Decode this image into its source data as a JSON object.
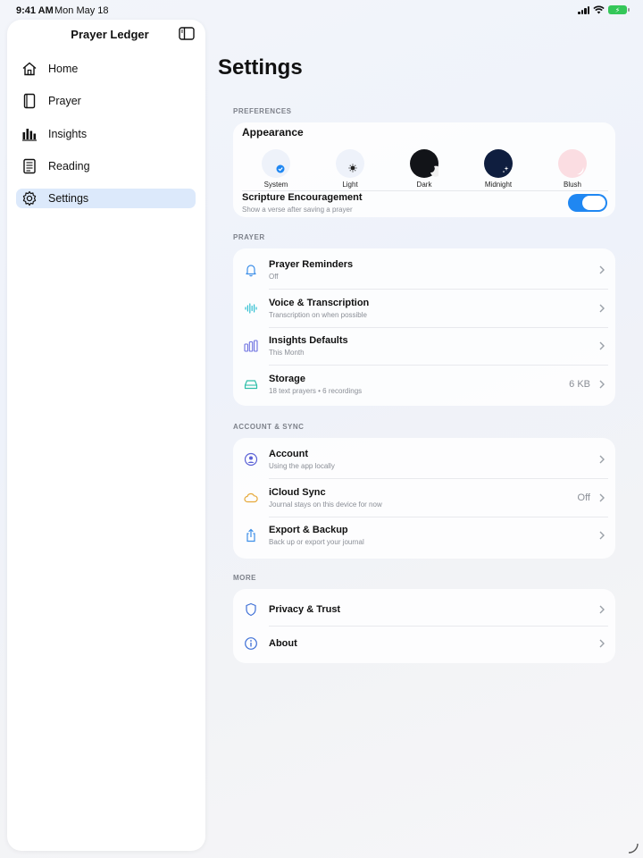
{
  "status_bar": {
    "time": "9:41 AM",
    "date": "Mon May 18",
    "battery": "⚡"
  },
  "sidebar": {
    "title": "Prayer Ledger",
    "items": [
      {
        "label": "Home",
        "icon": "house-icon"
      },
      {
        "label": "Prayer",
        "icon": "book-icon"
      },
      {
        "label": "Insights",
        "icon": "bar-chart-icon"
      },
      {
        "label": "Reading",
        "icon": "document-icon"
      },
      {
        "label": "Settings",
        "icon": "gear-icon",
        "active": true
      }
    ]
  },
  "page": {
    "title": "Settings"
  },
  "preferences": {
    "section_label": "PREFERENCES",
    "appearance_title": "Appearance",
    "themes": [
      {
        "label": "System",
        "selected": true,
        "color": "#f1f4fb"
      },
      {
        "label": "Light",
        "color": "#f1f4fb"
      },
      {
        "label": "Dark",
        "color": "#121418"
      },
      {
        "label": "Midnight",
        "color": "#0f1e3f"
      },
      {
        "label": "Blush",
        "color": "#fbdde2"
      }
    ],
    "scripture": {
      "title": "Scripture Encouragement",
      "subtitle": "Show a verse after saving a prayer",
      "enabled": true
    }
  },
  "prayer": {
    "section_label": "PRAYER",
    "rows": [
      {
        "title": "Prayer Reminders",
        "subtitle": "Off",
        "icon": "bell-icon",
        "value": ""
      },
      {
        "title": "Voice & Transcription",
        "subtitle": "Transcription on when possible",
        "icon": "waveform-icon",
        "value": ""
      },
      {
        "title": "Insights Defaults",
        "subtitle": "This Month",
        "icon": "chart-icon",
        "value": ""
      },
      {
        "title": "Storage",
        "subtitle": "18 text prayers • 6 recordings",
        "icon": "drive-icon",
        "value": "6 KB"
      }
    ]
  },
  "account_sync": {
    "section_label": "ACCOUNT & SYNC",
    "rows": [
      {
        "title": "Account",
        "subtitle": "Using the app locally",
        "icon": "person-icon",
        "value": ""
      },
      {
        "title": "iCloud Sync",
        "subtitle": "Journal stays on this device for now",
        "icon": "cloud-icon",
        "value": "Off"
      },
      {
        "title": "Export & Backup",
        "subtitle": "Back up or export your journal",
        "icon": "share-icon",
        "value": ""
      }
    ]
  },
  "more": {
    "section_label": "MORE",
    "rows": [
      {
        "title": "Privacy & Trust",
        "icon": "shield-icon"
      },
      {
        "title": "About",
        "icon": "info-icon"
      }
    ]
  },
  "colors": {
    "accent": "#1f87f2",
    "active_nav": "#dce9fb"
  }
}
